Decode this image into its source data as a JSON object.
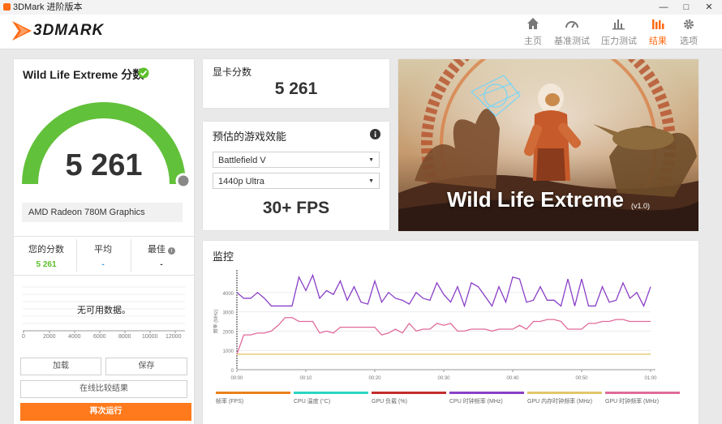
{
  "window": {
    "title": "3DMark 进阶版本"
  },
  "brand": {
    "logo_text": "3DMARK"
  },
  "nav": [
    {
      "label": "主页",
      "icon": "home-icon"
    },
    {
      "label": "基准测试",
      "icon": "gauge-icon"
    },
    {
      "label": "压力测试",
      "icon": "bars-icon"
    },
    {
      "label": "结果",
      "icon": "results-icon",
      "active": true
    },
    {
      "label": "选项",
      "icon": "gear-icon"
    }
  ],
  "score_panel": {
    "title": "Wild Life Extreme 分数",
    "score": "5 261",
    "score_value": 5261,
    "gpu": "AMD Radeon 780M Graphics",
    "your_score_label": "您的分数",
    "your_score": "5 261",
    "avg_label": "平均",
    "avg_value": "-",
    "best_label": "最佳",
    "best_value": "-",
    "no_data": "无可用数据。",
    "axis_ticks": [
      "0",
      "2000",
      "4000",
      "6000",
      "8000",
      "10000",
      "12000"
    ],
    "load_label": "加载",
    "save_label": "保存",
    "compare_label": "在线比较结果",
    "run_again_label": "再次运行"
  },
  "gpu_card": {
    "title": "显卡分数",
    "score": "5 261"
  },
  "perf_card": {
    "title": "预估的游戏效能",
    "game": "Battlefield V",
    "preset": "1440p Ultra",
    "fps": "30+ FPS"
  },
  "hero": {
    "title": "Wild Life Extreme",
    "version": "(v1.0)"
  },
  "monitor": {
    "title": "监控",
    "ylabel": "频率 (MHz)",
    "legend": [
      {
        "name": "帧率 (FPS)",
        "color": "#e8811c"
      },
      {
        "name": "CPU 温度 (°C)",
        "color": "#2ad6c1"
      },
      {
        "name": "GPU 负载 (%)",
        "color": "#c42c2c"
      },
      {
        "name": "CPU 时钟频率 (MHz)",
        "color": "#8a3fc7"
      },
      {
        "name": "GPU 内存时钟频率 (MHz)",
        "color": "#e2c76a"
      },
      {
        "name": "GPU 时钟频率 (MHz)",
        "color": "#e06a9a"
      }
    ]
  },
  "chart_data": {
    "type": "line",
    "ylabel": "频率 (MHz)",
    "ylim": [
      0,
      5000
    ],
    "yticks": [
      "0",
      "1000",
      "2000",
      "3000",
      "4000"
    ],
    "xticks": [
      "00:00",
      "00:10",
      "00:20",
      "00:30",
      "00:40",
      "00:50",
      "01:00"
    ],
    "x": [
      0,
      1,
      2,
      3,
      4,
      5,
      6,
      7,
      8,
      9,
      10,
      11,
      12,
      13,
      14,
      15,
      16,
      17,
      18,
      19,
      20,
      21,
      22,
      23,
      24,
      25,
      26,
      27,
      28,
      29,
      30,
      31,
      32,
      33,
      34,
      35,
      36,
      37,
      38,
      39,
      40,
      41,
      42,
      43,
      44,
      45,
      46,
      47,
      48,
      49,
      50,
      51,
      52,
      53,
      54,
      55,
      56,
      57,
      58,
      59,
      60
    ],
    "series": [
      {
        "name": "CPU 时钟频率 (MHz)",
        "color": "#8a3fc7",
        "values": [
          4000,
          3700,
          3700,
          4000,
          3700,
          3300,
          3300,
          3300,
          3300,
          4800,
          4100,
          4900,
          3700,
          4100,
          3900,
          4600,
          3600,
          4300,
          3500,
          3400,
          4600,
          3500,
          4000,
          3700,
          3600,
          3400,
          4000,
          3700,
          3600,
          4500,
          3900,
          3500,
          4300,
          3300,
          4500,
          4300,
          3800,
          3300,
          4300,
          3500,
          4800,
          4700,
          3500,
          3600,
          4300,
          3600,
          3600,
          3300,
          4700,
          3300,
          4700,
          3300,
          3300,
          4300,
          3500,
          3600,
          4500,
          3700,
          4000,
          3300,
          4300
        ]
      },
      {
        "name": "GPU 时钟频率 (MHz)",
        "color": "#e06a9a",
        "values": [
          800,
          1800,
          1800,
          1900,
          1900,
          2000,
          2300,
          2700,
          2700,
          2500,
          2500,
          2500,
          1900,
          2000,
          1900,
          2200,
          2200,
          2200,
          2200,
          2200,
          2200,
          1800,
          1900,
          2100,
          1900,
          2400,
          2000,
          2100,
          2100,
          2400,
          2300,
          2400,
          2000,
          2000,
          2100,
          2100,
          2100,
          2000,
          2100,
          2100,
          2100,
          2300,
          2100,
          2500,
          2500,
          2600,
          2600,
          2500,
          2100,
          2100,
          2100,
          2400,
          2400,
          2500,
          2500,
          2600,
          2600,
          2500,
          2500,
          2500,
          2500
        ]
      },
      {
        "name": "GPU 内存时钟频率 (MHz)",
        "color": "#e2c76a",
        "values": [
          800,
          800,
          800,
          800,
          800,
          800,
          800,
          800,
          800,
          800,
          800,
          800,
          800,
          800,
          800,
          800,
          800,
          800,
          800,
          800,
          800,
          800,
          800,
          800,
          800,
          800,
          800,
          800,
          800,
          800,
          800,
          800,
          800,
          800,
          800,
          800,
          800,
          800,
          800,
          800,
          800,
          800,
          800,
          800,
          800,
          800,
          800,
          800,
          800,
          800,
          800,
          800,
          800,
          800,
          800,
          800,
          800,
          800,
          800,
          800,
          800
        ]
      }
    ]
  }
}
